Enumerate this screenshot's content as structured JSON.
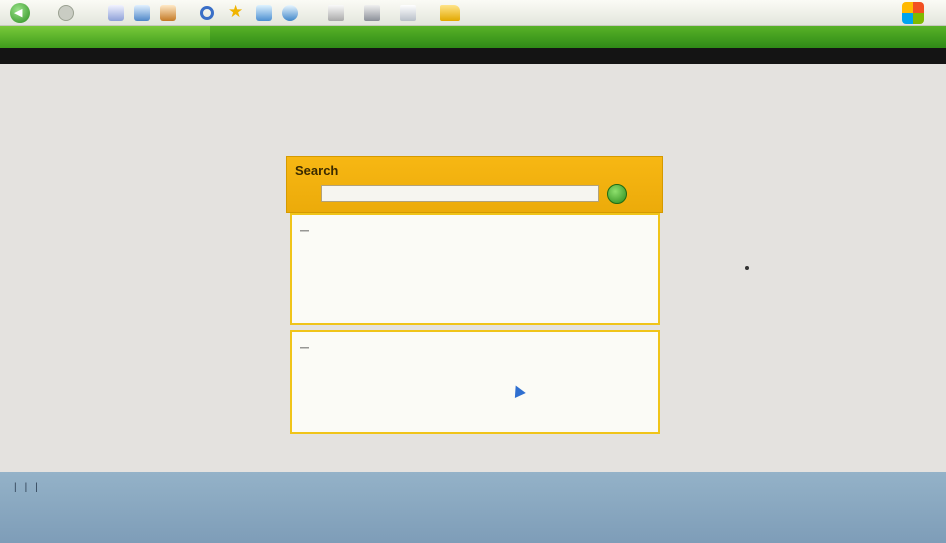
{
  "toolbar": {
    "icons": [
      "back-icon",
      "forward-icon",
      "stop-icon",
      "refresh-icon",
      "home-icon",
      "search-icon",
      "favorites-icon",
      "history-icon",
      "mail-icon",
      "print-icon",
      "edit-icon",
      "discuss-icon",
      "folder-icon",
      "windows-logo-icon"
    ]
  },
  "header": {
    "brand": "",
    "right_link": ""
  },
  "nav": {
    "items": [
      "",
      "",
      "",
      ""
    ],
    "right": ""
  },
  "main": {
    "intro": "",
    "search": {
      "title": "Search",
      "link": "",
      "input_value": "",
      "input_placeholder": ""
    },
    "tips": {
      "heading": "",
      "items": [
        {
          "text_black": "",
          "text_red": ""
        },
        {
          "text_black": "",
          "text_red": ""
        },
        {
          "text_black": "",
          "text_red": ""
        }
      ],
      "more_link": ""
    },
    "news": {
      "heading": "",
      "items": [
        "",
        "",
        ""
      ]
    }
  },
  "footer": {
    "links": [
      "",
      "",
      "",
      ""
    ]
  },
  "colors": {
    "header_green": "#3f9c1c",
    "search_orange": "#f0b10f",
    "box_border": "#f0c419",
    "footer_blue": "#88a7c0",
    "link_blue": "#2a57c6",
    "tip_red": "#b43a2d"
  }
}
